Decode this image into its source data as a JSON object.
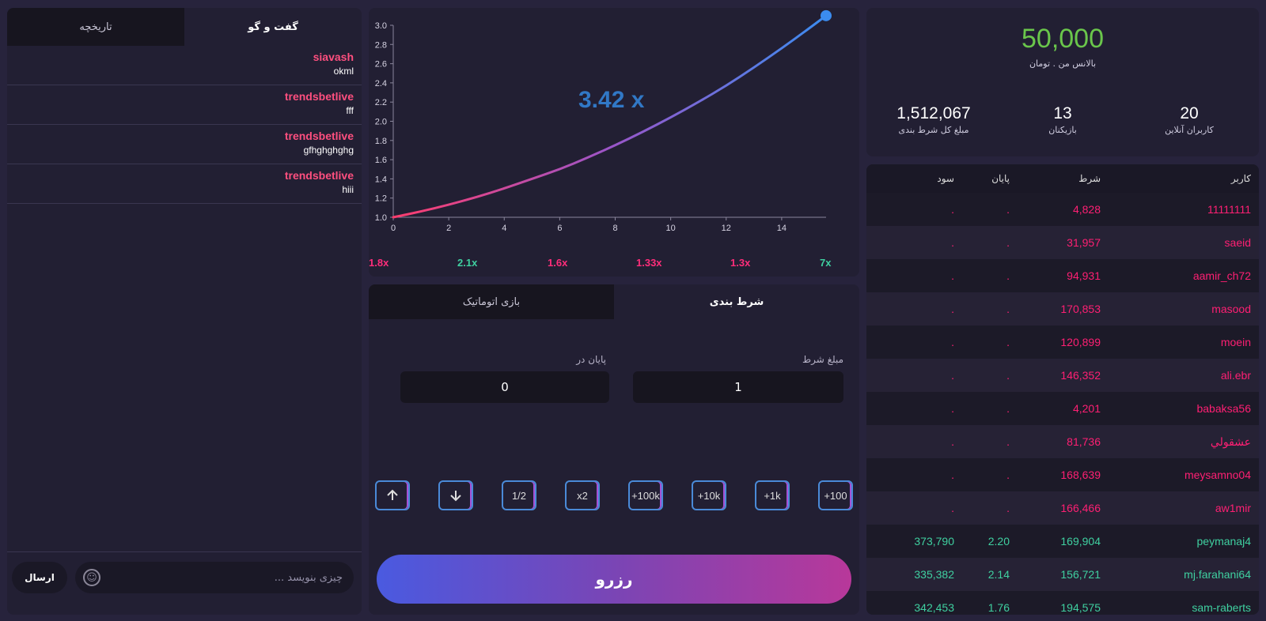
{
  "chat": {
    "tabs": [
      {
        "label": "گفت و گو"
      },
      {
        "label": "تاریخچه"
      }
    ],
    "messages": [
      {
        "user": "siavash",
        "text": "okml"
      },
      {
        "user": "trendsbetlive",
        "text": "fff"
      },
      {
        "user": "trendsbetlive",
        "text": "gfhghghghg"
      },
      {
        "user": "trendsbetlive",
        "text": "hiii"
      }
    ],
    "input_placeholder": "چیزی بنویسد ...",
    "send_label": "ارسال",
    "emoji_icon": "smiley-icon"
  },
  "chart_data": {
    "type": "line",
    "title": "",
    "xlabel": "",
    "ylabel": "",
    "xlim": [
      0,
      15.6
    ],
    "ylim": [
      1.0,
      3.0
    ],
    "x_ticks": [
      0,
      2,
      4,
      6,
      8,
      10,
      12,
      14
    ],
    "y_ticks": [
      "1.0",
      "1.2",
      "1.4",
      "1.6",
      "1.8",
      "2.0",
      "2.2",
      "2.4",
      "2.6",
      "2.8",
      "3.0"
    ],
    "x": [
      0,
      1,
      2,
      3,
      4,
      5,
      6,
      7,
      8,
      9,
      10,
      11,
      12,
      13,
      14,
      15,
      15.6
    ],
    "y": [
      1.0,
      1.06,
      1.13,
      1.21,
      1.3,
      1.4,
      1.5,
      1.62,
      1.75,
      1.89,
      2.04,
      2.2,
      2.37,
      2.56,
      2.76,
      2.97,
      3.1
    ],
    "gradient_colors": [
      "#ff3d6e",
      "#9b55c8",
      "#3b8cf0"
    ],
    "end_marker_color": "#3b8cf0"
  },
  "game": {
    "multiplier": "3.42 x",
    "history": [
      {
        "value": "1.8x",
        "color": "#ff2d7a"
      },
      {
        "value": "2.1x",
        "color": "#3fd0a0"
      },
      {
        "value": "1.6x",
        "color": "#ff2d7a"
      },
      {
        "value": "1.33x",
        "color": "#ff2d7a"
      },
      {
        "value": "1.3x",
        "color": "#ff2d7a"
      },
      {
        "value": "7x",
        "color": "#3fd0a0"
      }
    ]
  },
  "bet": {
    "tabs": [
      {
        "label": "شرط بندی"
      },
      {
        "label": "بازی اتوماتیک"
      }
    ],
    "amount_label": "مبلغ شرط",
    "amount_value": "1",
    "cashout_label": "پایان در",
    "cashout_value": "0",
    "quick_buttons": [
      "+100",
      "+1k",
      "+10k",
      "+100k",
      "x2",
      "1/2"
    ],
    "down_icon": "arrow-down-icon",
    "up_icon": "arrow-up-icon",
    "reserve_label": "رزرو"
  },
  "stats": {
    "balance": "50,000",
    "balance_label": "بالانس من . تومان",
    "online_value": "20",
    "online_label": "کاربران آنلاین",
    "players_value": "13",
    "players_label": "بازیکنان",
    "total_value": "1,512,067",
    "total_label": "مبلغ کل شرط بندی"
  },
  "table": {
    "headers": {
      "user": "کاربر",
      "bet": "شرط",
      "end": "پایان",
      "profit": "سود"
    },
    "colors": {
      "pending": "#ff1f73",
      "won": "#3fd0a0"
    },
    "rows": [
      {
        "user": "11111111",
        "bet": "4,828",
        "end": ".",
        "profit": ".",
        "status": "pending"
      },
      {
        "user": "saeid",
        "bet": "31,957",
        "end": ".",
        "profit": ".",
        "status": "pending"
      },
      {
        "user": "aamir_ch72",
        "bet": "94,931",
        "end": ".",
        "profit": ".",
        "status": "pending"
      },
      {
        "user": "masood",
        "bet": "170,853",
        "end": ".",
        "profit": ".",
        "status": "pending"
      },
      {
        "user": "moein",
        "bet": "120,899",
        "end": ".",
        "profit": ".",
        "status": "pending"
      },
      {
        "user": "ali.ebr",
        "bet": "146,352",
        "end": ".",
        "profit": ".",
        "status": "pending"
      },
      {
        "user": "babaksa56",
        "bet": "4,201",
        "end": ".",
        "profit": ".",
        "status": "pending"
      },
      {
        "user": "عشقولي",
        "bet": "81,736",
        "end": ".",
        "profit": ".",
        "status": "pending"
      },
      {
        "user": "meysamno04",
        "bet": "168,639",
        "end": ".",
        "profit": ".",
        "status": "pending"
      },
      {
        "user": "aw1mir",
        "bet": "166,466",
        "end": ".",
        "profit": ".",
        "status": "pending"
      },
      {
        "user": "peymanaj4",
        "bet": "169,904",
        "end": "2.20",
        "profit": "373,790",
        "status": "won"
      },
      {
        "user": "mj.farahani64",
        "bet": "156,721",
        "end": "2.14",
        "profit": "335,382",
        "status": "won"
      },
      {
        "user": "sam-raberts",
        "bet": "194,575",
        "end": "1.76",
        "profit": "342,453",
        "status": "won"
      }
    ]
  }
}
